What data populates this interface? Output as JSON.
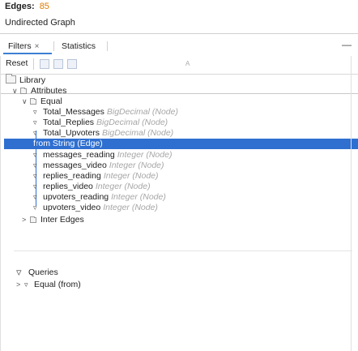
{
  "summary": {
    "edges_label": "Edges:",
    "edges_value": "85",
    "graph_type": "Undirected Graph"
  },
  "tabs": [
    {
      "label": "Filters",
      "close": "×",
      "active": true
    },
    {
      "label": "Statistics",
      "active": false
    }
  ],
  "minimize_glyph": "—",
  "toolbar": {
    "reset_label": "Reset",
    "a_glyph": "A"
  },
  "tree": {
    "library": "Library",
    "attributes": "Attributes",
    "equal": "Equal",
    "items": [
      {
        "label": "Total_Messages",
        "type": "BigDecimal (Node)"
      },
      {
        "label": "Total_Replies",
        "type": "BigDecimal (Node)"
      },
      {
        "label": "Total_Upvoters",
        "type": "BigDecimal (Node)"
      },
      {
        "label": "from String (Edge)",
        "type": ""
      },
      {
        "label": "messages_reading",
        "type": "Integer (Node)"
      },
      {
        "label": "messages_video",
        "type": "Integer (Node)"
      },
      {
        "label": "replies_reading",
        "type": "Integer (Node)"
      },
      {
        "label": "replies_video",
        "type": "Integer (Node)"
      },
      {
        "label": "upvoters_reading",
        "type": "Integer (Node)"
      },
      {
        "label": "upvoters_video",
        "type": "Integer (Node)"
      }
    ],
    "inter_edges": "Inter Edges"
  },
  "queries": {
    "label": "Queries",
    "item": "Equal (from)"
  },
  "colors": {
    "accent": "#2f6fd0",
    "edges_value": "#e07a00",
    "type_hint": "#a6a6a6"
  }
}
